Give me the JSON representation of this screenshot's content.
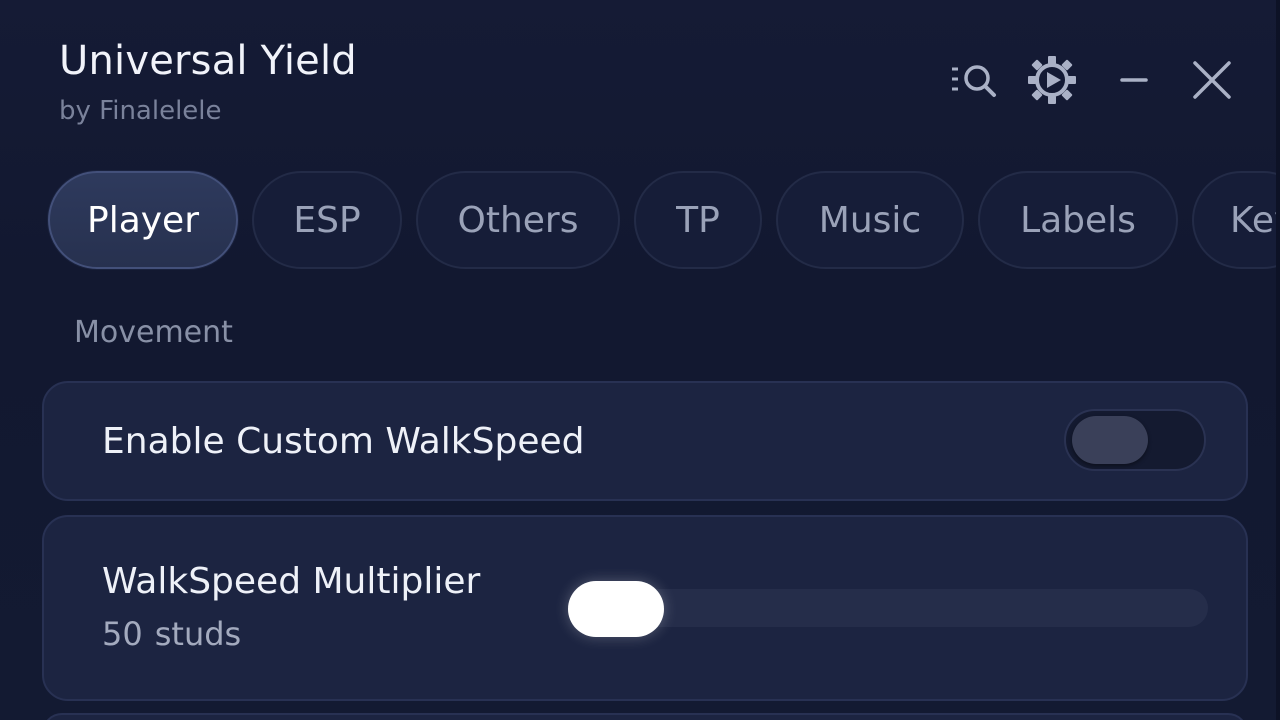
{
  "header": {
    "title": "Universal Yield",
    "subtitle": "by Finalelele",
    "icons": [
      "search-list-icon",
      "settings-gear-icon",
      "minimize-icon",
      "close-icon"
    ]
  },
  "tabs": [
    {
      "label": "Player",
      "active": true
    },
    {
      "label": "ESP",
      "active": false
    },
    {
      "label": "Others",
      "active": false
    },
    {
      "label": "TP",
      "active": false
    },
    {
      "label": "Music",
      "active": false
    },
    {
      "label": "Labels",
      "active": false
    },
    {
      "label": "Key",
      "active": false
    }
  ],
  "section": {
    "label": "Movement"
  },
  "toggle_setting": {
    "label": "Enable Custom WalkSpeed",
    "enabled": false
  },
  "slider_setting": {
    "label": "WalkSpeed Multiplier",
    "value": "50",
    "unit": "studs",
    "level_fraction": 0
  },
  "colors": {
    "background": "#121830",
    "card": "#1c2441",
    "active_tab": "#2e3a5d",
    "text": "#eef1f8",
    "muted": "#7a829b"
  }
}
